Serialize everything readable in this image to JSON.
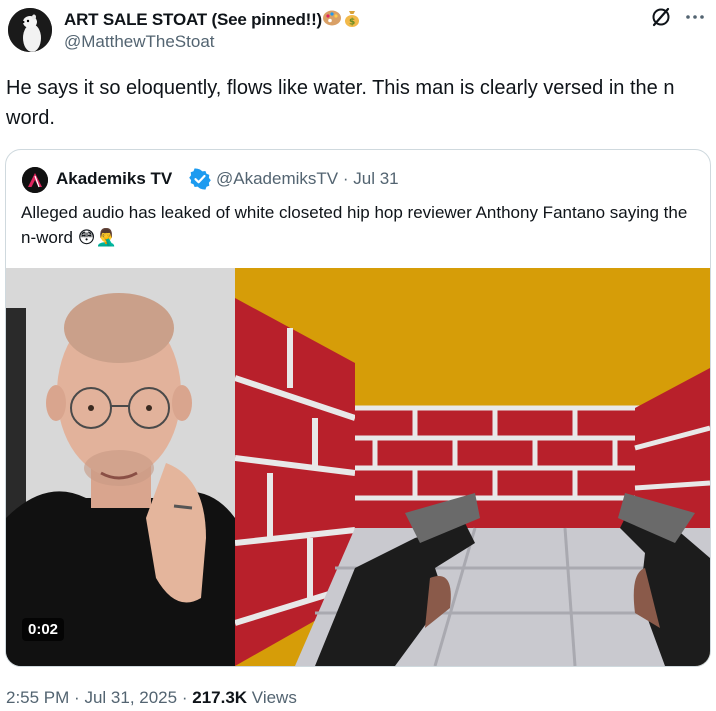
{
  "author": {
    "display_name": "ART SALE STOAT (See pinned!!)",
    "handle": "@MatthewTheStoat",
    "avatar_icon": "stoat-avatar"
  },
  "tweet": {
    "text": "He says it so eloquently, flows like water. This man is clearly versed in the n word."
  },
  "quoted_tweet": {
    "display_name": "Akademiks TV",
    "verified": true,
    "handle": "@AkademiksTV",
    "separator": "·",
    "date": "Jul 31",
    "text": "Alleged audio has leaked of white closeted hip hop reviewer Anthony Fantano saying the n-word",
    "emojis": [
      "😳",
      "🤦‍♂️"
    ],
    "video_duration": "0:02"
  },
  "footer": {
    "time": "2:55 PM",
    "separator1": "·",
    "date": "Jul 31, 2025",
    "separator2": "·",
    "views_count": "217.3K",
    "views_label": "Views"
  },
  "colors": {
    "text_primary": "#0f1419",
    "text_secondary": "#536471",
    "border": "#cfd9de",
    "verified_blue": "#1d9bf0"
  }
}
